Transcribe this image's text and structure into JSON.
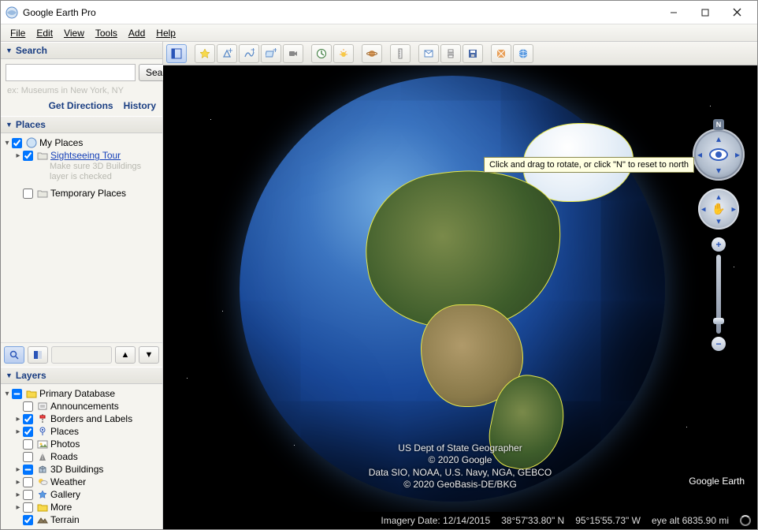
{
  "window": {
    "title": "Google Earth Pro"
  },
  "menu": {
    "file": "File",
    "edit": "Edit",
    "view": "View",
    "tools": "Tools",
    "add": "Add",
    "help": "Help"
  },
  "search": {
    "header": "Search",
    "placeholder": "",
    "button": "Search",
    "hint": "ex: Museums in New York, NY",
    "directions": "Get Directions",
    "history": "History"
  },
  "places": {
    "header": "Places",
    "myplaces": "My Places",
    "tour": "Sightseeing Tour",
    "tour_note1": "Make sure 3D Buildings",
    "tour_note2": "layer is checked",
    "temp": "Temporary Places"
  },
  "layers": {
    "header": "Layers",
    "items": [
      {
        "label": "Primary Database",
        "checked": "mixed",
        "expandable": true
      },
      {
        "label": "Announcements",
        "checked": false,
        "expandable": false
      },
      {
        "label": "Borders and Labels",
        "checked": true,
        "expandable": true
      },
      {
        "label": "Places",
        "checked": true,
        "expandable": true
      },
      {
        "label": "Photos",
        "checked": false,
        "expandable": false
      },
      {
        "label": "Roads",
        "checked": false,
        "expandable": false
      },
      {
        "label": "3D Buildings",
        "checked": "mixed",
        "expandable": true
      },
      {
        "label": "Weather",
        "checked": false,
        "expandable": true
      },
      {
        "label": "Gallery",
        "checked": false,
        "expandable": true
      },
      {
        "label": "More",
        "checked": false,
        "expandable": true
      },
      {
        "label": "Terrain",
        "checked": true,
        "expandable": false
      }
    ]
  },
  "tooltip": "Click and drag to rotate, or click \"N\" to reset to north",
  "compass_n": "N",
  "attribution": {
    "l1": "US Dept of State Geographer",
    "l2": "© 2020 Google",
    "l3": "Data SIO, NOAA, U.S. Navy, NGA, GEBCO",
    "l4": "© 2020 GeoBasis-DE/BKG"
  },
  "logo": {
    "g": "Google ",
    "e": "Earth"
  },
  "status": {
    "imagery": "Imagery Date: 12/14/2015",
    "lat": "38°57'33.80\" N",
    "lon": "95°15'55.73\" W",
    "alt": "eye alt 6835.90 mi"
  }
}
